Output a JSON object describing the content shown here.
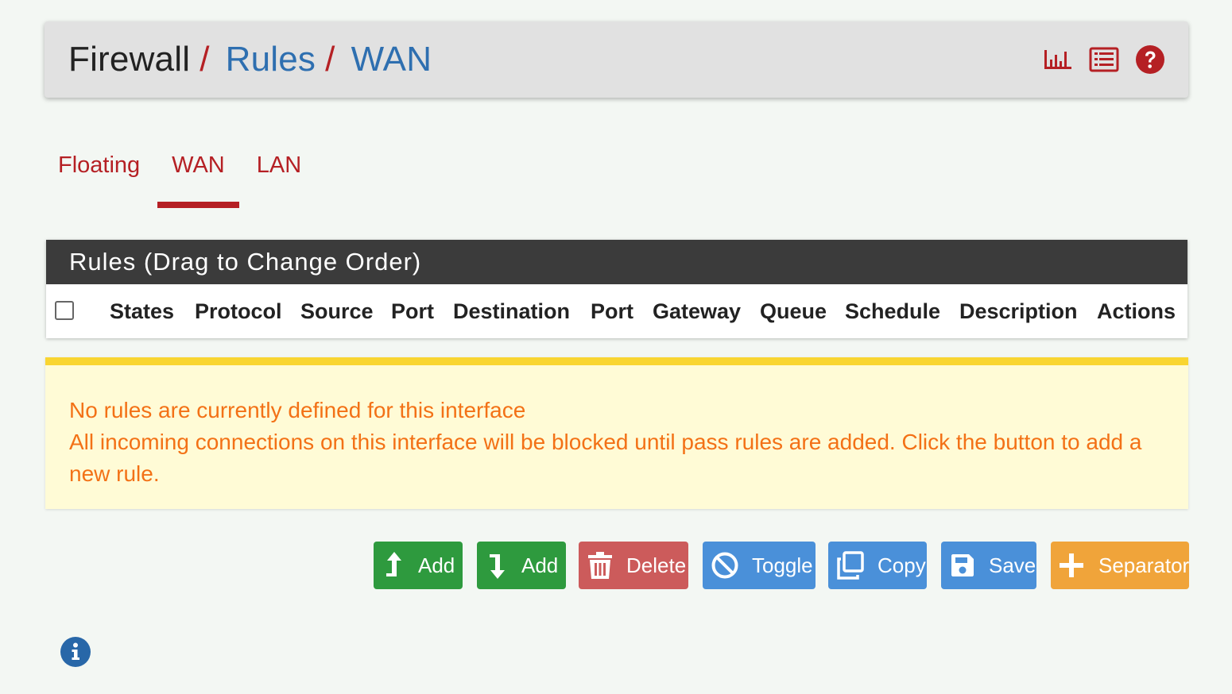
{
  "breadcrumb": {
    "root": "Firewall",
    "separator": "/",
    "section": "Rules",
    "current": "WAN"
  },
  "header_icons": [
    "bar-chart-icon",
    "list-icon",
    "help-icon"
  ],
  "tabs": [
    {
      "label": "Floating",
      "active": false
    },
    {
      "label": "WAN",
      "active": true
    },
    {
      "label": "LAN",
      "active": false
    }
  ],
  "rules_table": {
    "heading": "Rules (Drag to Change Order)",
    "columns": [
      "States",
      "Protocol",
      "Source",
      "Port",
      "Destination",
      "Port",
      "Gateway",
      "Queue",
      "Schedule",
      "Description",
      "Actions"
    ]
  },
  "warning": {
    "line1": "No rules are currently defined for this interface",
    "line2": "All incoming connections on this interface will be blocked until pass rules are added. Click the button to add a new rule."
  },
  "buttons": {
    "add_top": "Add",
    "add_bottom": "Add",
    "delete": "Delete",
    "toggle": "Toggle",
    "copy": "Copy",
    "save": "Save",
    "separator": "Separator"
  },
  "colors": {
    "brand_red": "#b52024",
    "link_blue": "#2e6fb0",
    "warning_text": "#f37116",
    "warning_bar": "#f9d531",
    "success_green": "#2e9a3e",
    "danger_red": "#cc5b5b",
    "info_blue": "#4a90d9",
    "warn_orange": "#f0a43a"
  }
}
